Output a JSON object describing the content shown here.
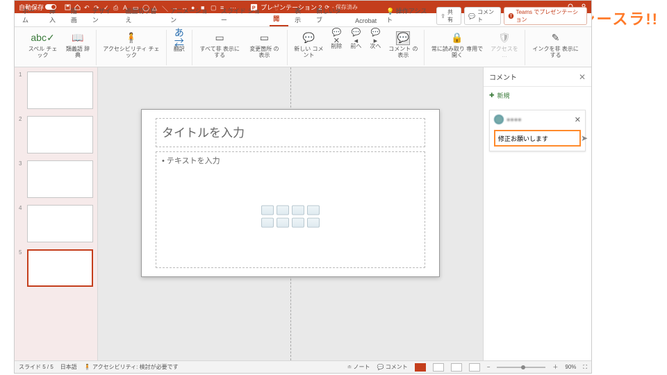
{
  "watermark": "シースラ!!",
  "titlebar": {
    "autosave_label": "自動保存",
    "doc_icon_name": "presentation-icon",
    "doc_title": "プレゼンテーション 2",
    "saved_state": "- 保存済み"
  },
  "tabs": {
    "items": [
      "ホーム",
      "挿入",
      "描画",
      "デザイン",
      "画面切り替え",
      "アニメーション",
      "スライド ショー",
      "校閲",
      "表示",
      "新しいタブ",
      "Acrobat",
      "操作アシスト"
    ],
    "active_index": 7,
    "share_label": "共有",
    "comment_label": "コメント",
    "teams_label": "Teams でプレゼンテーション"
  },
  "ribbon": {
    "spell": "スペル\nチェック",
    "thesaurus": "類義語\n辞典",
    "accessibility": "アクセシビリティ\nチェック",
    "translate": "翻訳",
    "hide_all": "すべて非\n表示にする",
    "change_mark": "変更箇所\nの表示",
    "new_comment": "新しい\nコメント",
    "delete": "削除",
    "prev": "前へ",
    "next": "次へ",
    "show_comments": "コメント\nの表示",
    "read_aloud": "常に読み取り\n専用で開く",
    "accessto": "アクセスを\n…",
    "ink_hide": "インクを非\n表示にする"
  },
  "thumbs": {
    "count": 5,
    "selected": 5
  },
  "slide": {
    "title_placeholder": "タイトルを入力",
    "body_placeholder": "• テキストを入力"
  },
  "comments": {
    "header": "コメント",
    "new_label": "新規",
    "user_name": "●●●●",
    "input_value": "修正お願いします"
  },
  "status": {
    "slide_pos": "スライド 5 / 5",
    "lang": "日本語",
    "a11y": "アクセシビリティ: 検討が必要です",
    "notes": "ノート",
    "comments": "コメント",
    "zoom": "90%"
  }
}
